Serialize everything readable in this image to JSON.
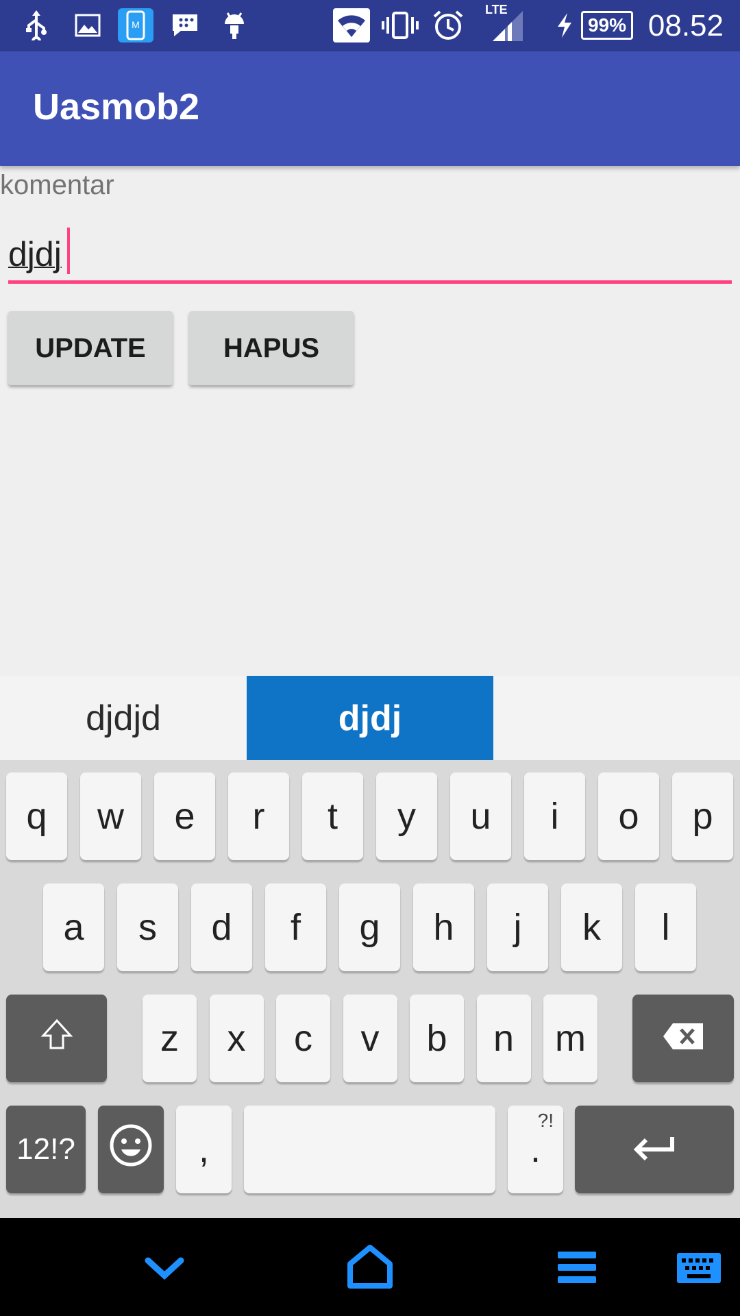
{
  "status_bar": {
    "time": "08.52",
    "battery": "99%",
    "network": "LTE",
    "icons": [
      "usb-icon",
      "gallery-icon",
      "phone-app-icon",
      "messenger-icon",
      "android-debug-icon",
      "wifi-icon",
      "vibrate-icon",
      "alarm-icon",
      "signal-icon",
      "charging-icon",
      "battery-icon"
    ]
  },
  "app_bar": {
    "title": "Uasmob2"
  },
  "form": {
    "label": "komentar",
    "input_value": "djdj",
    "update_label": "UPDATE",
    "delete_label": "HAPUS"
  },
  "suggestions": {
    "items": [
      "djdjd",
      "djdj",
      ""
    ],
    "active_index": 1
  },
  "keyboard": {
    "row1": [
      "q",
      "w",
      "e",
      "r",
      "t",
      "y",
      "u",
      "i",
      "o",
      "p"
    ],
    "row2": [
      "a",
      "s",
      "d",
      "f",
      "g",
      "h",
      "j",
      "k",
      "l"
    ],
    "row3": [
      "z",
      "x",
      "c",
      "v",
      "b",
      "n",
      "m"
    ],
    "symbols_label": "12!?",
    "comma_label": ",",
    "period_label": ".",
    "period_sub": "?!",
    "shift_icon": "shift-icon",
    "backspace_icon": "backspace-icon",
    "emoji_icon": "emoji-icon",
    "enter_icon": "enter-icon"
  },
  "nav_bar": {
    "icons": [
      "back-down-icon",
      "home-icon",
      "menu-icon",
      "keyboard-icon"
    ],
    "accent": "#1e90ff"
  },
  "colors": {
    "status_bar": "#2d3c91",
    "app_bar": "#3f51b5",
    "accent": "#ff4081",
    "suggestion_active": "#0f73c6"
  }
}
